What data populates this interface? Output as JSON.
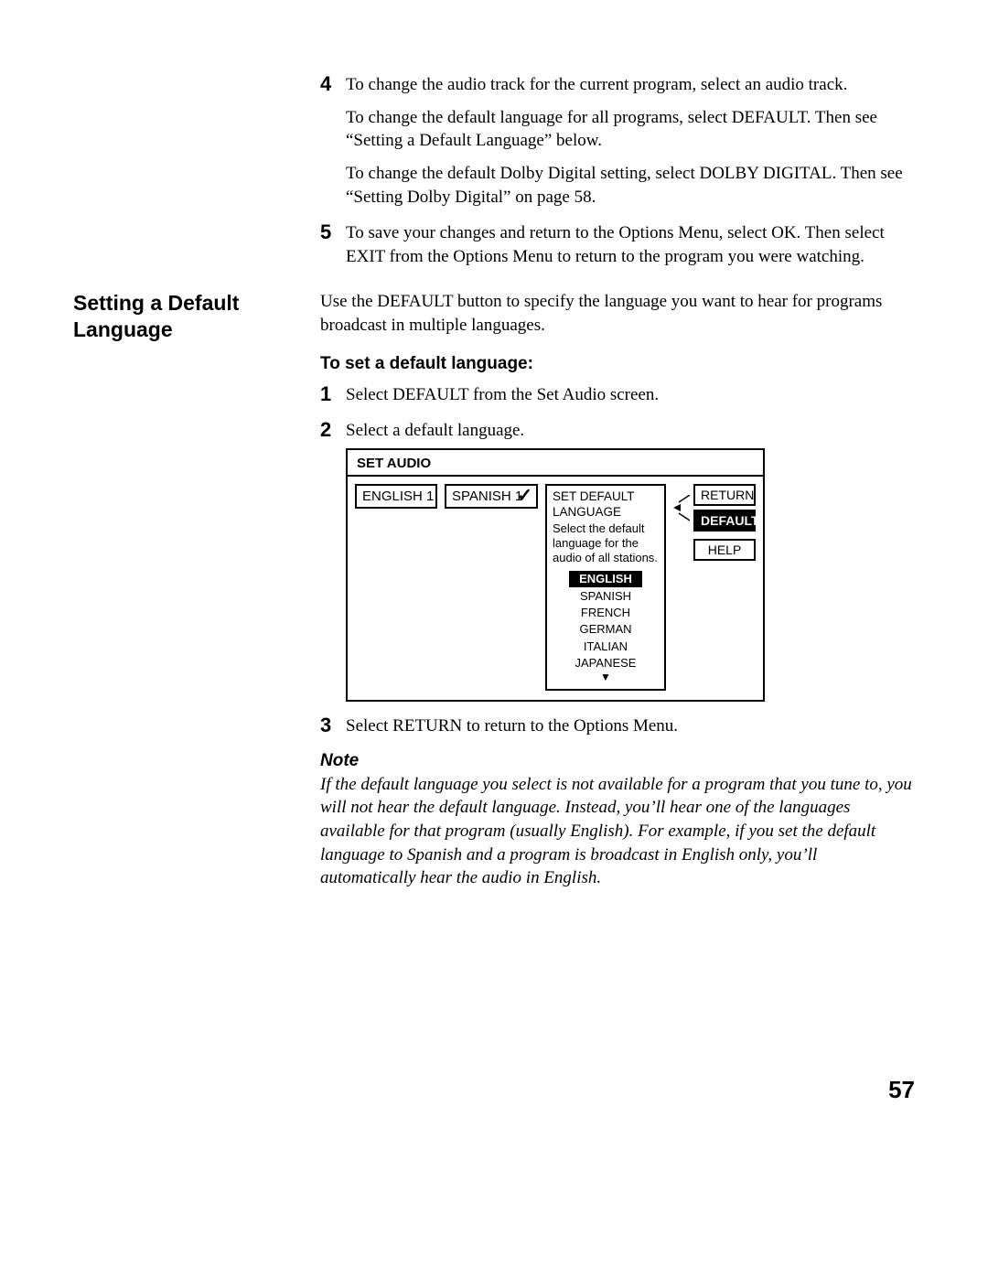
{
  "steps_top": [
    {
      "num": "4",
      "paras": [
        "To change the audio track for the current program, select an audio track.",
        "To change the default language for all programs, select DEFAULT. Then see “Setting a Default Language” below.",
        "To change the default Dolby Digital setting, select DOLBY DIGITAL. Then see “Setting Dolby Digital” on page 58."
      ]
    },
    {
      "num": "5",
      "paras": [
        "To save your changes and return to the Options Menu, select OK. Then select EXIT from the Options Menu to return to the program you were watching."
      ]
    }
  ],
  "section": {
    "heading": "Setting a Default Language",
    "intro": "Use the DEFAULT button to specify the language you want to hear for programs broadcast in multiple languages.",
    "sub_heading": "To set a default language:"
  },
  "steps_setting": [
    {
      "num": "1",
      "paras": [
        "Select DEFAULT from the Set Audio screen."
      ]
    },
    {
      "num": "2",
      "paras": [
        "Select a default language."
      ]
    }
  ],
  "diagram": {
    "title": "SET AUDIO",
    "tracks": [
      "ENGLISH 1",
      "SPANISH 1"
    ],
    "checked_track_index": 1,
    "panel_title": "SET DEFAULT LANGUAGE",
    "panel_desc": "Select the default language for the audio of all stations.",
    "languages": [
      "ENGLISH",
      "SPANISH",
      "FRENCH",
      "GERMAN",
      "ITALIAN",
      "JAPANESE"
    ],
    "selected_language_index": 0,
    "scroll_arrow": "▼",
    "side_buttons": [
      {
        "label": "RETURN",
        "selected": false
      },
      {
        "label": "DEFAULT",
        "selected": true
      },
      {
        "label": "HELP",
        "selected": false
      }
    ]
  },
  "step_after_diagram": {
    "num": "3",
    "paras": [
      "Select RETURN to return to the Options Menu."
    ]
  },
  "note": {
    "heading": "Note",
    "body": "If the default language you select is not available for a program that you tune to, you will not hear the default language. Instead, you’ll hear one of the languages available for that program (usually English). For example, if you set the default language to Spanish and a program is broadcast in English only, you’ll automatically hear the audio in English."
  },
  "page_number": "57"
}
